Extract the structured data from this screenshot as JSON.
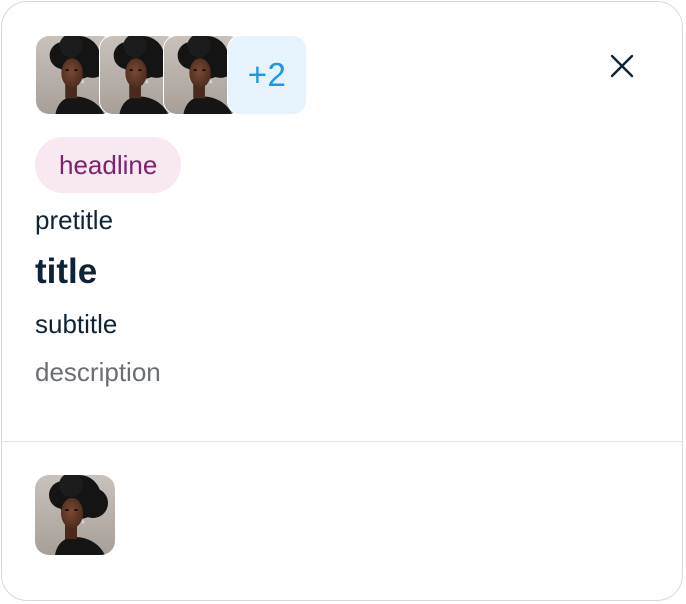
{
  "card": {
    "avatars": [
      {
        "name": "avatar-1"
      },
      {
        "name": "avatar-2"
      },
      {
        "name": "avatar-3"
      }
    ],
    "more_count_label": "+2",
    "close_icon": "close-icon",
    "headline": "headline",
    "pretitle": "pretitle",
    "title": "title",
    "subtitle": "subtitle",
    "description": "description"
  },
  "colors": {
    "headline_bg": "#f7e8f2",
    "headline_text": "#7c236c",
    "more_badge_bg": "#e6f3fd",
    "more_badge_text": "#1a97e8",
    "text_primary": "#0f2336",
    "text_secondary": "#6b6e72"
  }
}
